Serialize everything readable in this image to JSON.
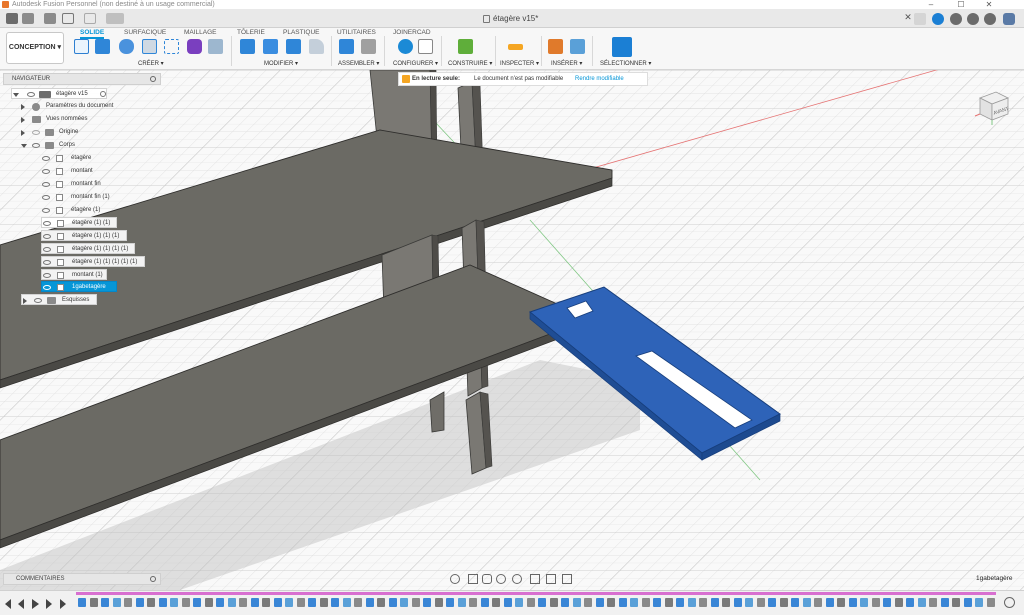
{
  "window": {
    "title": "Autodesk Fusion Personnel (non destiné à un usage commercial)",
    "minimize": "–",
    "maximize": "☐",
    "close": "✕"
  },
  "document_tab": {
    "name": "étagère v15*"
  },
  "workspace": {
    "mode_label": "CONCEPTION ▾"
  },
  "ribbon": {
    "tabs": [
      "SOLIDE",
      "SURFACIQUE",
      "MAILLAGE",
      "TÔLERIE",
      "PLASTIQUE",
      "UTILITAIRES",
      "JOINERCAD"
    ],
    "active_tab": "SOLIDE",
    "groups": [
      "CRÉER ▾",
      "MODIFIER ▾",
      "ASSEMBLER ▾",
      "CONFIGURER ▾",
      "CONSTRUIRE ▾",
      "INSPECTER ▾",
      "INSÉRER ▾",
      "SÉLECTIONNER ▾"
    ]
  },
  "readonly_banner": {
    "title": "En lecture seule:",
    "message": "Le document n'est pas modifiable",
    "link": "Rendre modifiable"
  },
  "navigator": {
    "header": "NAVIGATEUR",
    "root": "étagère v15",
    "items": [
      {
        "label": "Paramètres du document"
      },
      {
        "label": "Vues nommées"
      },
      {
        "label": "Origine"
      },
      {
        "label": "Corps"
      },
      {
        "label": "étagère"
      },
      {
        "label": "montant"
      },
      {
        "label": "montant fin"
      },
      {
        "label": "montant fin (1)"
      },
      {
        "label": "étagère (1)"
      },
      {
        "label": "étagère (1) (1)"
      },
      {
        "label": "étagère (1) (1) (1)"
      },
      {
        "label": "étagère (1) (1) (1) (1)"
      },
      {
        "label": "étagère (1) (1) (1) (1) (1)"
      },
      {
        "label": "montant (1)"
      },
      {
        "label": "1gabetagère"
      },
      {
        "label": "Esquisses"
      }
    ]
  },
  "viewcube": {
    "face_label": "AVANT"
  },
  "comments": {
    "label": "COMMENTAIRES"
  },
  "status": {
    "selection": "1gabetagère"
  },
  "colors": {
    "accent": "#0696d7",
    "part_blue": "#2e63b8",
    "shelf_gray": "#6b6a64",
    "timeline_track": "#d86fd0"
  }
}
